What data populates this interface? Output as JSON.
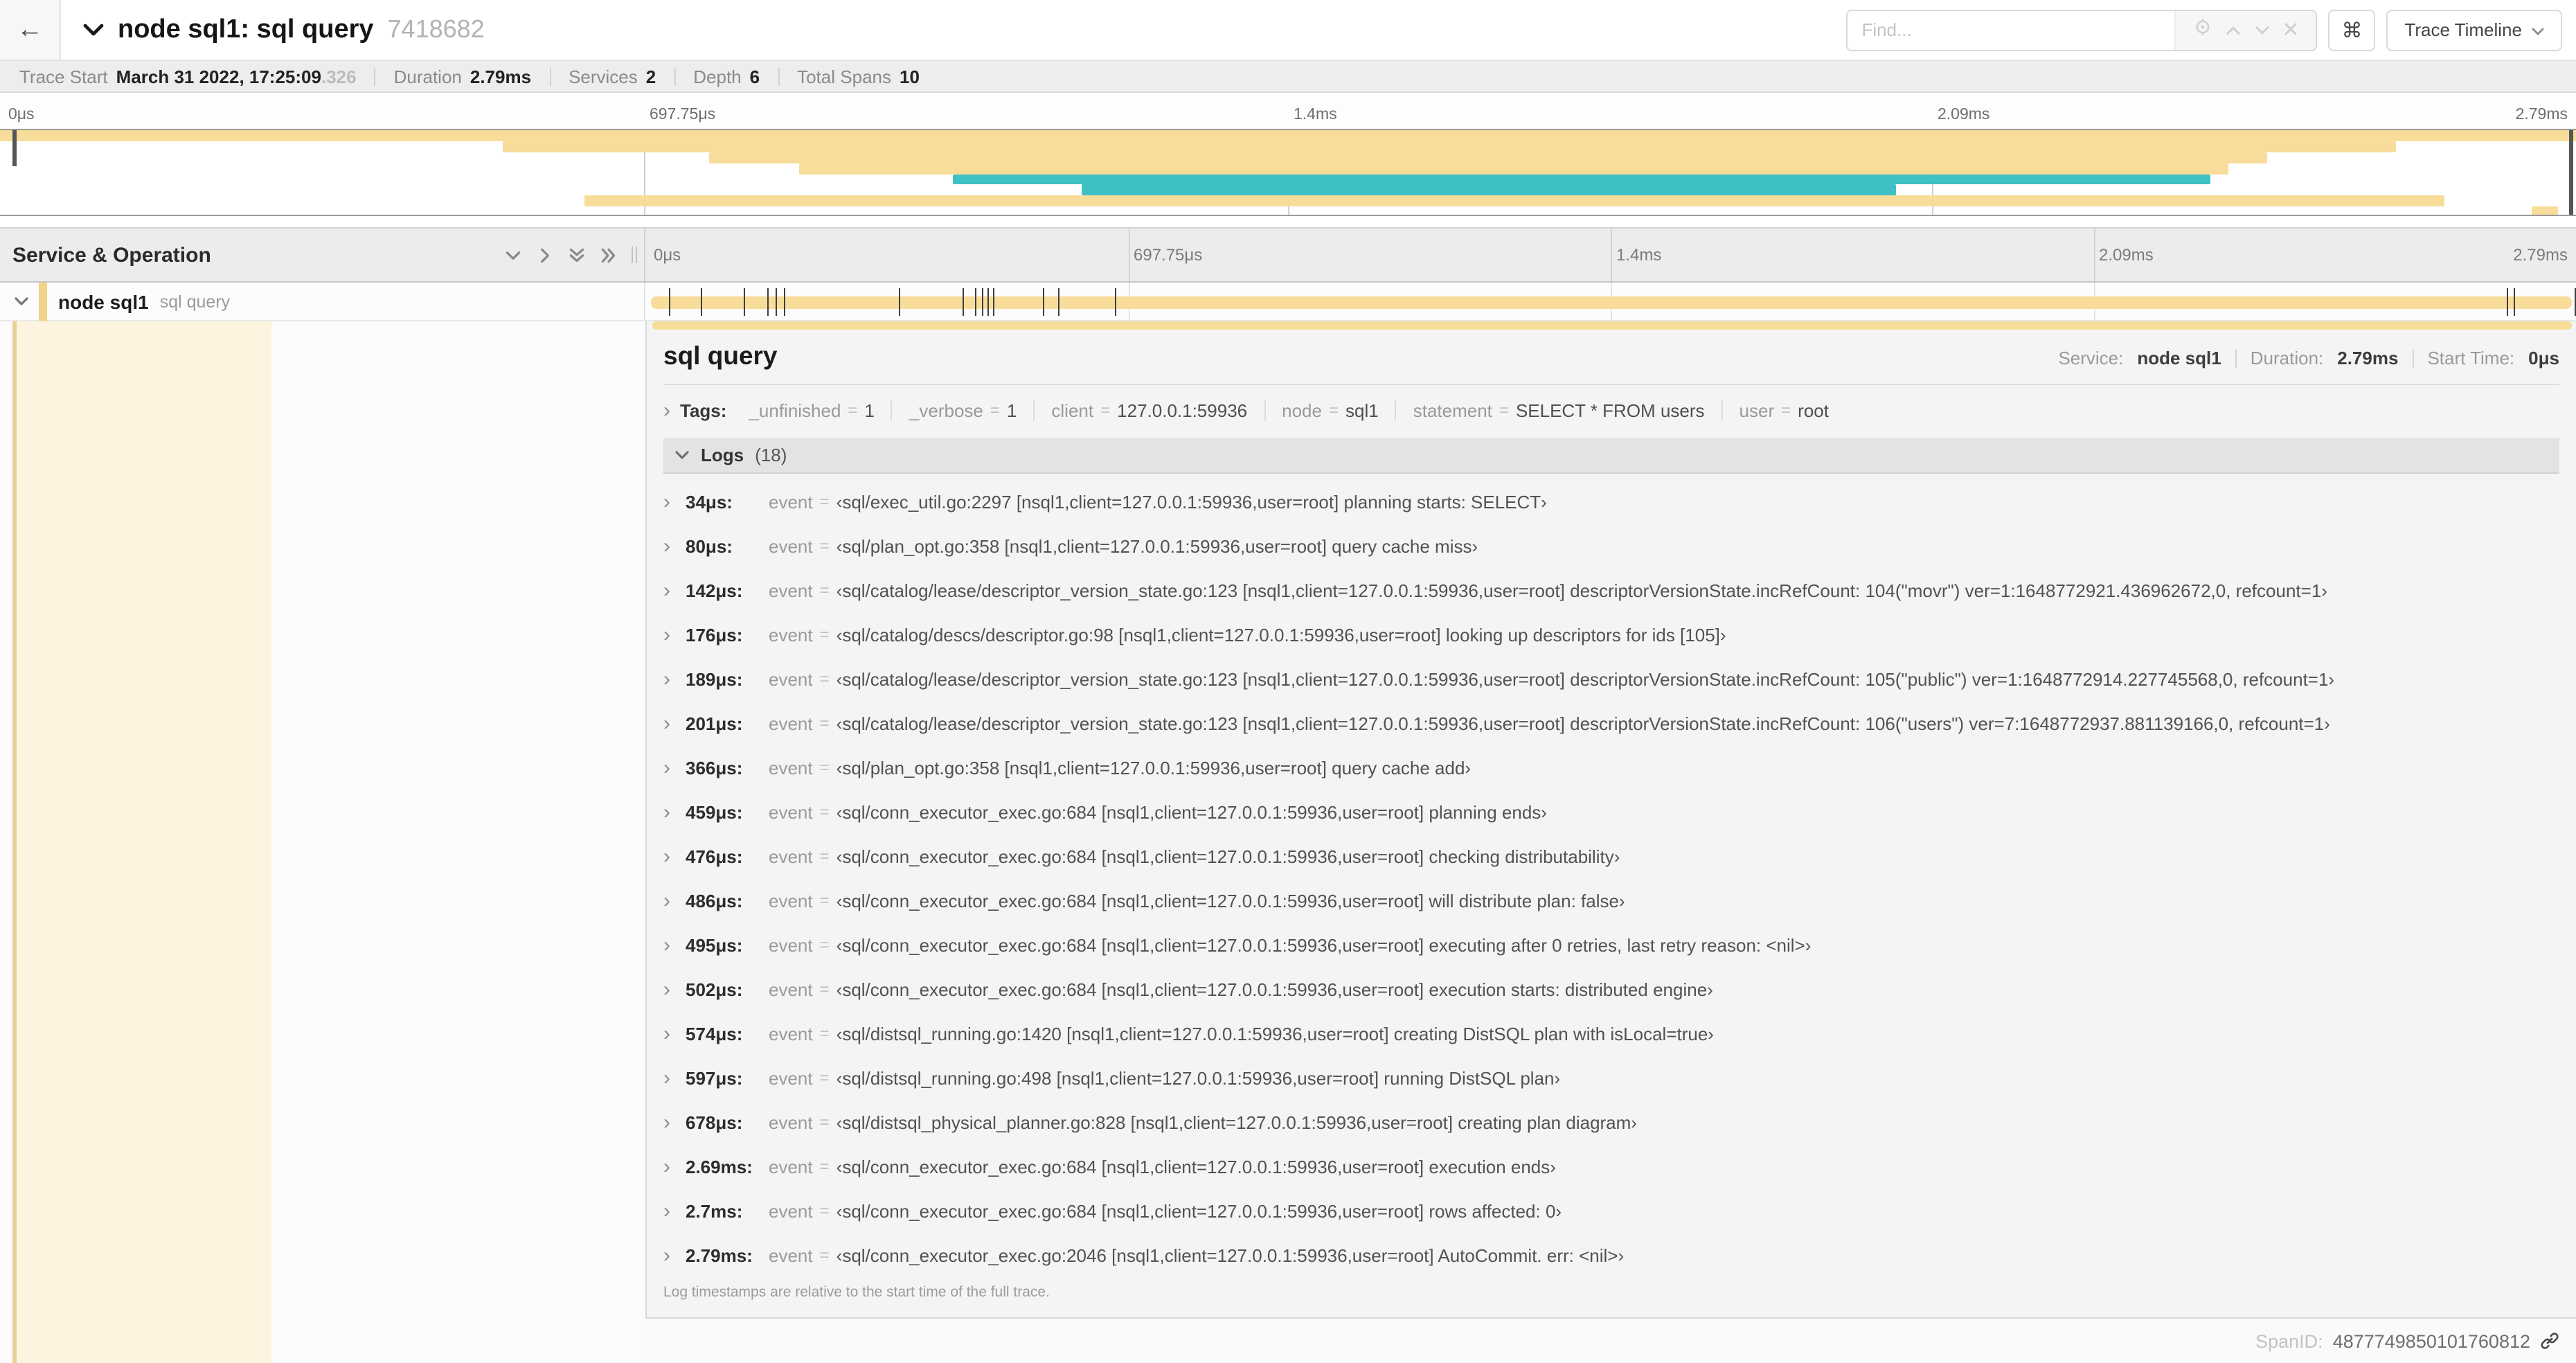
{
  "header": {
    "back_icon": "←",
    "title": "node sql1: sql query",
    "trace_id_short": "7418682",
    "find_placeholder": "Find...",
    "shortcuts_symbol": "⌘",
    "view_selector": "Trace Timeline"
  },
  "summary": {
    "items": [
      {
        "label": "Trace Start",
        "value": "March 31 2022, 17:25:09",
        "suffix": ".326"
      },
      {
        "label": "Duration",
        "value": "2.79ms"
      },
      {
        "label": "Services",
        "value": "2"
      },
      {
        "label": "Depth",
        "value": "6"
      },
      {
        "label": "Total Spans",
        "value": "10"
      }
    ]
  },
  "colors": {
    "tan": "#f7dd99",
    "tan_accent": "#f2d388",
    "teal": "#3fc0c4",
    "cream": "#fcf4de"
  },
  "minimap": {
    "ticks": [
      "0μs",
      "697.75μs",
      "1.4ms",
      "2.09ms",
      "2.79ms"
    ],
    "rows": [
      {
        "start": 0,
        "end": 100,
        "color": "tan"
      },
      {
        "start": 19.5,
        "end": 93,
        "color": "tan"
      },
      {
        "start": 27.5,
        "end": 88,
        "color": "tan"
      },
      {
        "start": 31,
        "end": 86.5,
        "color": "tan"
      },
      {
        "start": 37,
        "end": 85.8,
        "color": "teal"
      },
      {
        "start": 42,
        "end": 73.6,
        "color": "teal"
      },
      {
        "start": 22.7,
        "end": 94.9,
        "color": "tan"
      },
      {
        "start": 98.3,
        "end": 99.3,
        "color": "tan"
      }
    ]
  },
  "grid": {
    "left_header": "Service & Operation",
    "ruler_ticks": [
      "0μs",
      "697.75μs",
      "1.4ms",
      "2.09ms",
      "2.79ms"
    ],
    "span_row": {
      "service": "node sql1",
      "operation": "sql query",
      "log_marker_pcts": [
        1.22,
        2.87,
        5.09,
        6.31,
        6.77,
        7.2,
        13.12,
        16.45,
        17.06,
        17.42,
        17.74,
        18.0,
        20.57,
        21.4,
        24.3,
        96.4,
        96.8,
        99.9
      ]
    }
  },
  "detail": {
    "operation": "sql query",
    "service_label": "Service:",
    "service": "node sql1",
    "duration_label": "Duration:",
    "duration": "2.79ms",
    "start_label": "Start Time:",
    "start": "0μs",
    "tags_label": "Tags:",
    "tags": [
      {
        "key": "_unfinished",
        "value": "1"
      },
      {
        "key": "_verbose",
        "value": "1"
      },
      {
        "key": "client",
        "value": "127.0.0.1:59936"
      },
      {
        "key": "node",
        "value": "sql1"
      },
      {
        "key": "statement",
        "value": "SELECT * FROM users"
      },
      {
        "key": "user",
        "value": "root"
      }
    ],
    "logs_label": "Logs",
    "logs_count": "(18)",
    "logs_key": "event",
    "logs": [
      {
        "ts": "34μs:",
        "value": "‹sql/exec_util.go:2297 [nsql1,client=127.0.0.1:59936,user=root] planning starts: SELECT›"
      },
      {
        "ts": "80μs:",
        "value": "‹sql/plan_opt.go:358 [nsql1,client=127.0.0.1:59936,user=root] query cache miss›"
      },
      {
        "ts": "142μs:",
        "value": "‹sql/catalog/lease/descriptor_version_state.go:123 [nsql1,client=127.0.0.1:59936,user=root] descriptorVersionState.incRefCount: 104(\"movr\") ver=1:1648772921.436962672,0, refcount=1›"
      },
      {
        "ts": "176μs:",
        "value": "‹sql/catalog/descs/descriptor.go:98 [nsql1,client=127.0.0.1:59936,user=root] looking up descriptors for ids [105]›"
      },
      {
        "ts": "189μs:",
        "value": "‹sql/catalog/lease/descriptor_version_state.go:123 [nsql1,client=127.0.0.1:59936,user=root] descriptorVersionState.incRefCount: 105(\"public\") ver=1:1648772914.227745568,0, refcount=1›"
      },
      {
        "ts": "201μs:",
        "value": "‹sql/catalog/lease/descriptor_version_state.go:123 [nsql1,client=127.0.0.1:59936,user=root] descriptorVersionState.incRefCount: 106(\"users\") ver=7:1648772937.881139166,0, refcount=1›"
      },
      {
        "ts": "366μs:",
        "value": "‹sql/plan_opt.go:358 [nsql1,client=127.0.0.1:59936,user=root] query cache add›"
      },
      {
        "ts": "459μs:",
        "value": "‹sql/conn_executor_exec.go:684 [nsql1,client=127.0.0.1:59936,user=root] planning ends›"
      },
      {
        "ts": "476μs:",
        "value": "‹sql/conn_executor_exec.go:684 [nsql1,client=127.0.0.1:59936,user=root] checking distributability›"
      },
      {
        "ts": "486μs:",
        "value": "‹sql/conn_executor_exec.go:684 [nsql1,client=127.0.0.1:59936,user=root] will distribute plan: false›"
      },
      {
        "ts": "495μs:",
        "value": "‹sql/conn_executor_exec.go:684 [nsql1,client=127.0.0.1:59936,user=root] executing after 0 retries, last retry reason: <nil>›"
      },
      {
        "ts": "502μs:",
        "value": "‹sql/conn_executor_exec.go:684 [nsql1,client=127.0.0.1:59936,user=root] execution starts: distributed engine›"
      },
      {
        "ts": "574μs:",
        "value": "‹sql/distsql_running.go:1420 [nsql1,client=127.0.0.1:59936,user=root] creating DistSQL plan with isLocal=true›"
      },
      {
        "ts": "597μs:",
        "value": "‹sql/distsql_running.go:498 [nsql1,client=127.0.0.1:59936,user=root] running DistSQL plan›"
      },
      {
        "ts": "678μs:",
        "value": "‹sql/distsql_physical_planner.go:828 [nsql1,client=127.0.0.1:59936,user=root] creating plan diagram›"
      },
      {
        "ts": "2.69ms:",
        "value": "‹sql/conn_executor_exec.go:684 [nsql1,client=127.0.0.1:59936,user=root] execution ends›"
      },
      {
        "ts": "2.7ms:",
        "value": "‹sql/conn_executor_exec.go:684 [nsql1,client=127.0.0.1:59936,user=root] rows affected: 0›"
      },
      {
        "ts": "2.79ms:",
        "value": "‹sql/conn_executor_exec.go:2046 [nsql1,client=127.0.0.1:59936,user=root] AutoCommit. err: <nil>›"
      }
    ],
    "footer_note": "Log timestamps are relative to the start time of the full trace.",
    "span_id_label": "SpanID:",
    "span_id": "4877749850101760812"
  }
}
